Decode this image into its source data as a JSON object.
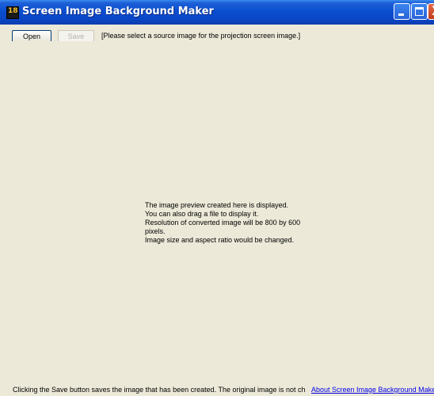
{
  "window": {
    "title": "Screen Image Background Maker",
    "app_icon_text": "18",
    "close_glyph": "X"
  },
  "toolbar": {
    "open_label": "Open",
    "save_label": "Save",
    "status": "[Please select a source image for the projection screen image.]"
  },
  "preview": {
    "lines": [
      "The image preview created here is displayed.",
      "You can also drag a file to display it.",
      "Resolution of converted image will be 800 by 600",
      "pixels.",
      "Image size and aspect ratio would be changed."
    ]
  },
  "footer": {
    "info": "Clicking the Save button saves the image that has been created. The original image is not ch",
    "about_link": "About Screen Image Background Maker"
  },
  "colors": {
    "titlebar": "#0a4fd0",
    "background": "#ece9d8",
    "link": "#0000ee"
  }
}
